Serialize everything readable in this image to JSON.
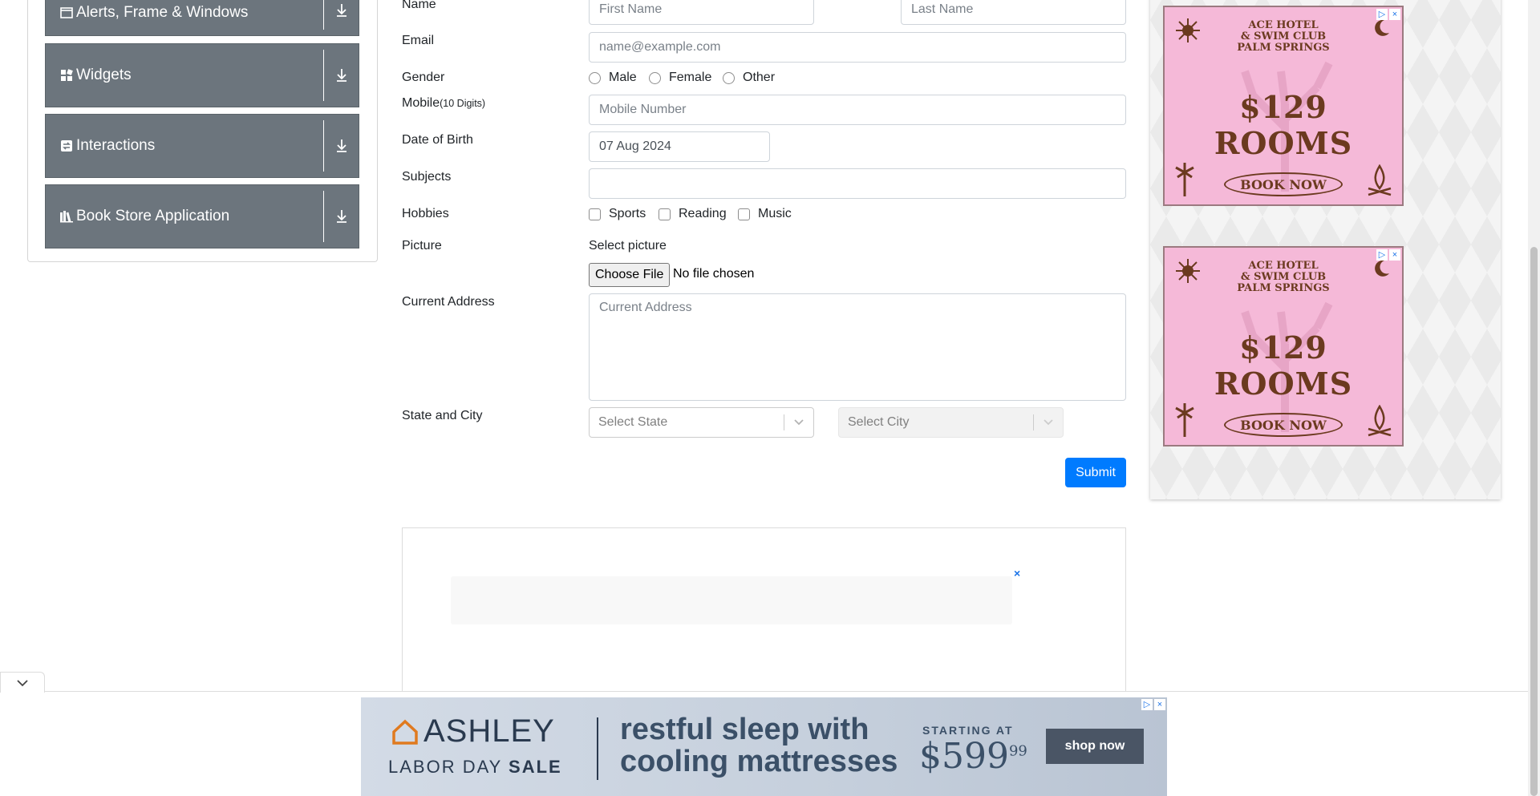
{
  "sidebar": {
    "groups": [
      {
        "label": "Alerts, Frame & Windows",
        "icon": "window-icon"
      },
      {
        "label": "Widgets",
        "icon": "widgets-icon"
      },
      {
        "label": "Interactions",
        "icon": "interactions-icon"
      },
      {
        "label": "Book Store Application",
        "icon": "books-icon"
      }
    ]
  },
  "form": {
    "name_label": "Name",
    "first_name_placeholder": "First Name",
    "last_name_placeholder": "Last Name",
    "email_label": "Email",
    "email_placeholder": "name@example.com",
    "gender_label": "Gender",
    "gender_options": [
      "Male",
      "Female",
      "Other"
    ],
    "mobile_label": "Mobile",
    "mobile_hint": "(10 Digits)",
    "mobile_placeholder": "Mobile Number",
    "dob_label": "Date of Birth",
    "dob_value": "07 Aug 2024",
    "subjects_label": "Subjects",
    "hobbies_label": "Hobbies",
    "hobby_options": [
      "Sports",
      "Reading",
      "Music"
    ],
    "picture_label": "Picture",
    "select_picture": "Select picture",
    "choose_file": "Choose File",
    "file_status": "No file chosen",
    "address_label": "Current Address",
    "address_placeholder": "Current Address",
    "state_city_label": "State and City",
    "state_placeholder": "Select State",
    "city_placeholder": "Select City",
    "submit_label": "Submit"
  },
  "ads": {
    "hotel": {
      "headline": [
        "ACE HOTEL",
        "& SWIM CLUB",
        "PALM SPRINGS"
      ],
      "price": "$129 ROOMS",
      "cta": "BOOK NOW"
    },
    "ashley": {
      "brand": "ASHLEY",
      "sale_prefix": "LABOR DAY",
      "sale_word": "SALE",
      "headline_1": "restful sleep with",
      "headline_2": "cooling mattresses",
      "starting": "STARTING AT",
      "price": "$599",
      "price_cents": "99",
      "cta": "shop now"
    },
    "close_glyph": "×"
  },
  "colors": {
    "sidebar_bg": "#6c757d",
    "primary": "#007bff",
    "hotel_ad_bg": "#f5b9d8",
    "hotel_ad_text": "#6b3a1f",
    "ashley_text": "#3b5068"
  }
}
